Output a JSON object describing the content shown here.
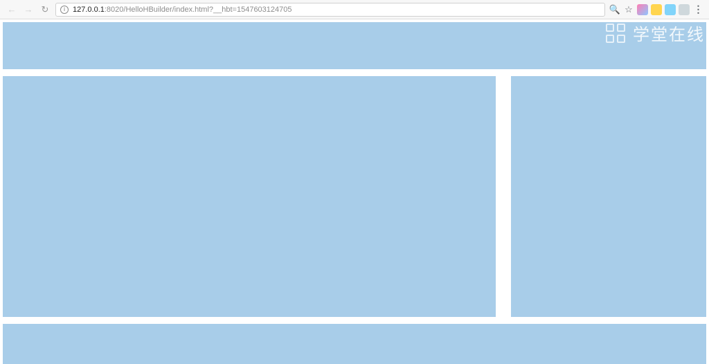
{
  "chrome": {
    "back_label": "Back",
    "forward_label": "Forward",
    "reload_label": "Reload",
    "info_label": "Site information",
    "url_host": "127.0.0.1",
    "url_port_path": ":8020/HelloHBuilder/index.html?__hbt=1547603124705",
    "zoom_label": "Zoom",
    "star_label": "Bookmark this page",
    "ext1_label": "Extension 1",
    "ext2_label": "Extension 2",
    "ext3_label": "Extension 3",
    "ext4_label": "Extension 4",
    "menu_label": "Customize and control"
  },
  "watermark": {
    "text": "学堂在线"
  },
  "layout": {
    "header_name": "header-block",
    "main_name": "main-content-block",
    "side_name": "sidebar-block",
    "footer_name": "footer-block"
  }
}
